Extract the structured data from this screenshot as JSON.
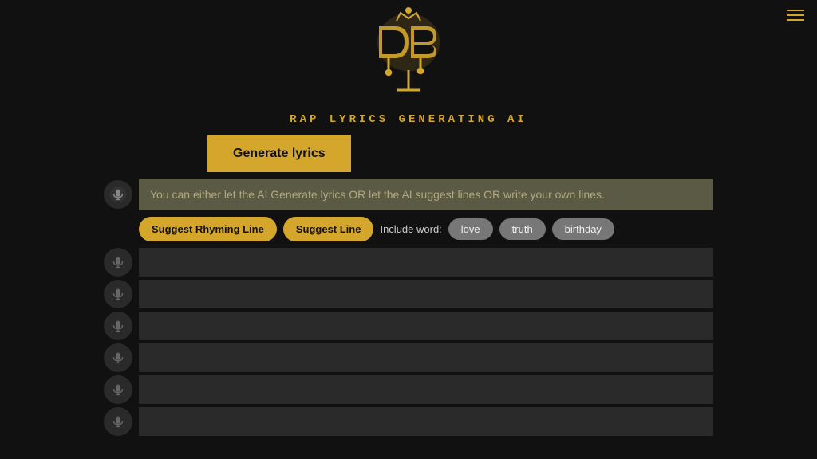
{
  "header": {
    "subtitle": "RAP LYRICS GENERATING AI",
    "logo_alt": "Deep Beat Logo"
  },
  "hamburger": {
    "aria_label": "Menu"
  },
  "toolbar": {
    "generate_label": "Generate lyrics"
  },
  "first_line": {
    "placeholder": "You can either let the AI Generate lyrics OR let the AI suggest lines OR write your own lines."
  },
  "action_buttons": {
    "suggest_rhyming": "Suggest Rhyming Line",
    "suggest_line": "Suggest Line",
    "include_label": "Include word:",
    "word_tags": [
      "love",
      "truth",
      "birthday"
    ]
  },
  "extra_rows": [
    {
      "id": 1
    },
    {
      "id": 2
    },
    {
      "id": 3
    },
    {
      "id": 4
    },
    {
      "id": 5
    },
    {
      "id": 6
    }
  ]
}
